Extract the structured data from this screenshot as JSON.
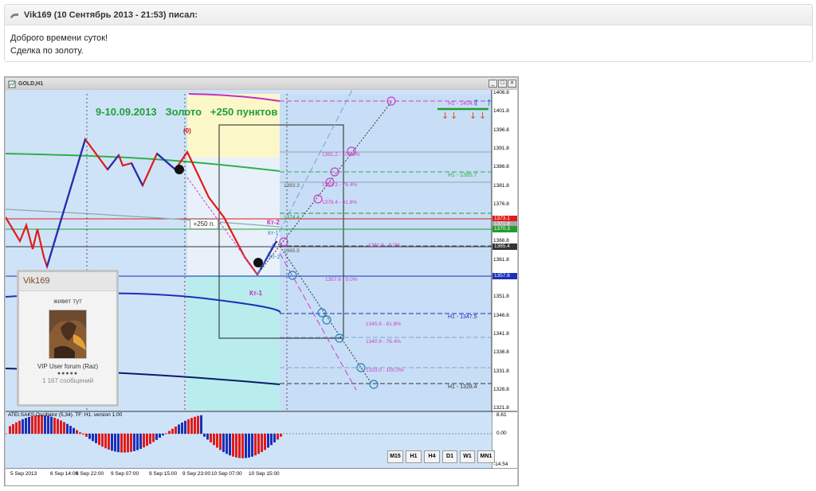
{
  "post": {
    "header": "Vik169 (10 Сентябрь 2013 - 21:53) писал:",
    "lines": [
      "Доброго времени суток!",
      "Сделка по золоту."
    ]
  },
  "window": {
    "title": "GOLD,H1",
    "buttons": [
      "_",
      "□",
      "×"
    ]
  },
  "chart": {
    "headline": "9-10.09.2013   Золото   +250 пунктов",
    "label_zero": "(0)",
    "label_plus": "+250 п.",
    "label_kt2": "Кт-2",
    "label_kt1": "Кт-1",
    "label_kt1b": "Кт-1",
    "label_kt2b": "Кт-2",
    "price_axis": [
      "1406.8",
      "1401.8",
      "1396.8",
      "1391.8",
      "1386.8",
      "1381.8",
      "1376.8",
      "1371.8",
      "1366.8",
      "1361.8",
      "1356.8",
      "1351.8",
      "1346.8",
      "1341.8",
      "1336.8",
      "1331.8",
      "1326.8",
      "1321.8"
    ],
    "price_tags": [
      {
        "text": "1373.1",
        "color": "#e11b1b"
      },
      {
        "text": "1371.8",
        "color": "#a8a8a8"
      },
      {
        "text": "1370.3",
        "color": "#1f9e2f"
      },
      {
        "text": "1365.4",
        "color": "#333333"
      },
      {
        "text": "1357.6",
        "color": "#1d2fb8"
      }
    ],
    "levels": [
      {
        "text": "H1 - 1404.8",
        "color": "#d23cc6"
      },
      {
        "text": "H1 - 1385.7",
        "color": "#2fb04a"
      },
      {
        "text": "H1 - 1347.5",
        "color": "#1d2fb8"
      },
      {
        "text": "H1 - 1328.4",
        "color": "#333333"
      }
    ],
    "fibo_up": [
      "1391.2 - 100.0%",
      "1383.3",
      "1383.3 - 76.4%",
      "1378.4 - 61.8%",
      "1374.4",
      "1365.5",
      "1361.6 - 0.0%"
    ],
    "fibo_down": [
      "1357.6 - 0.0%",
      "1345.8 - 61.8%",
      "1340.9 - 76.4%",
      "1333.0 - 100.0%"
    ],
    "oscillator": {
      "title": "ATEI.SAKS.Oscillator (5,34). TF: H1. version 1.00",
      "axis": [
        "8.61",
        "0.00",
        "-14.54"
      ]
    },
    "time_axis": [
      "5 Sep 2013",
      "6 Sep 14:00",
      "6 Sep 22:00",
      "9 Sep 07:00",
      "9 Sep 15:00",
      "9 Sep 23:00",
      "10 Sep 07:00",
      "10 Sep 15:00"
    ],
    "timeframes": [
      "M15",
      "H1",
      "H4",
      "D1",
      "W1",
      "MN1"
    ]
  },
  "profile": {
    "name": "Vik169",
    "status": "живет тут",
    "group": "VIP User forum (Raz)",
    "dots": "●●●●●",
    "posts": "1 167 сообщений"
  },
  "colors": {
    "chart_bg": "#cfe3f8",
    "bull": "#1d2fb8",
    "bear": "#e11b1b",
    "fibo": "#d23cc6",
    "headline": "#21a038"
  }
}
